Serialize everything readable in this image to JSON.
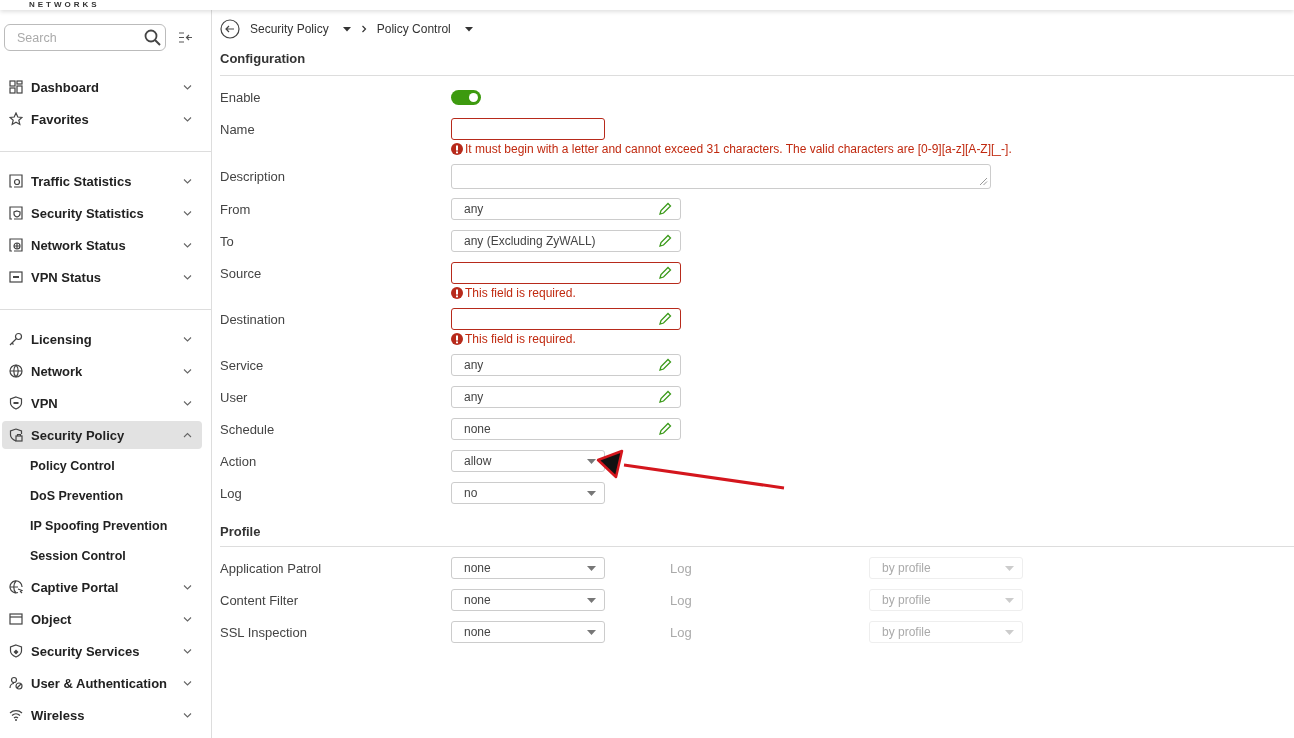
{
  "logo_text": "NETWORKS",
  "sidebar": {
    "search_placeholder": "Search",
    "groups": [
      {
        "items": [
          {
            "label": "Dashboard",
            "expanded": false,
            "selected": false
          },
          {
            "label": "Favorites",
            "expanded": false,
            "selected": false
          }
        ]
      },
      {
        "items": [
          {
            "label": "Traffic Statistics",
            "expanded": false,
            "selected": false
          },
          {
            "label": "Security Statistics",
            "expanded": false,
            "selected": false
          },
          {
            "label": "Network Status",
            "expanded": false,
            "selected": false
          },
          {
            "label": "VPN Status",
            "expanded": false,
            "selected": false
          }
        ]
      },
      {
        "items": [
          {
            "label": "Licensing",
            "expanded": false,
            "selected": false
          },
          {
            "label": "Network",
            "expanded": false,
            "selected": false
          },
          {
            "label": "VPN",
            "expanded": false,
            "selected": false
          },
          {
            "label": "Security Policy",
            "expanded": true,
            "selected": true,
            "children": [
              {
                "label": "Policy Control"
              },
              {
                "label": "DoS Prevention"
              },
              {
                "label": "IP Spoofing Prevention"
              },
              {
                "label": "Session Control"
              }
            ]
          },
          {
            "label": "Captive Portal",
            "expanded": false,
            "selected": false
          },
          {
            "label": "Object",
            "expanded": false,
            "selected": false
          },
          {
            "label": "Security Services",
            "expanded": false,
            "selected": false
          },
          {
            "label": "User & Authentication",
            "expanded": false,
            "selected": false
          },
          {
            "label": "Wireless",
            "expanded": false,
            "selected": false
          }
        ]
      }
    ]
  },
  "breadcrumb": [
    {
      "label": "Security Policy"
    },
    {
      "label": "Policy Control"
    }
  ],
  "configuration": {
    "title": "Configuration",
    "fields": [
      {
        "label": "Enable",
        "kind": "toggle",
        "on": true
      },
      {
        "label": "Name",
        "kind": "text",
        "invalid": true,
        "error": "It must begin with a letter and cannot exceed 31 characters. The valid characters are [0-9][a-z][A-Z][_-]."
      },
      {
        "label": "Description",
        "kind": "textarea",
        "invalid": false
      },
      {
        "label": "From",
        "kind": "picker",
        "value": "any",
        "invalid": false
      },
      {
        "label": "To",
        "kind": "picker",
        "value": "any (Excluding ZyWALL)",
        "invalid": false
      },
      {
        "label": "Source",
        "kind": "picker",
        "invalid": true,
        "error": "This field is required."
      },
      {
        "label": "Destination",
        "kind": "picker",
        "invalid": true,
        "error": "This field is required."
      },
      {
        "label": "Service",
        "kind": "picker",
        "value": "any",
        "invalid": false
      },
      {
        "label": "User",
        "kind": "picker",
        "value": "any",
        "invalid": false
      },
      {
        "label": "Schedule",
        "kind": "picker",
        "value": "none",
        "invalid": false
      },
      {
        "label": "Action",
        "kind": "select",
        "value": "allow",
        "invalid": false
      },
      {
        "label": "Log",
        "kind": "select",
        "value": "no",
        "invalid": false
      }
    ]
  },
  "profile": {
    "title": "Profile",
    "rows": [
      {
        "label": "Application Patrol",
        "value": "none",
        "log_label": "Log",
        "log_value": "by profile",
        "log_disabled": true
      },
      {
        "label": "Content Filter",
        "value": "none",
        "log_label": "Log",
        "log_value": "by profile",
        "log_disabled": true
      },
      {
        "label": "SSL Inspection",
        "value": "none",
        "log_label": "Log",
        "log_value": "by profile",
        "log_disabled": true
      }
    ]
  }
}
